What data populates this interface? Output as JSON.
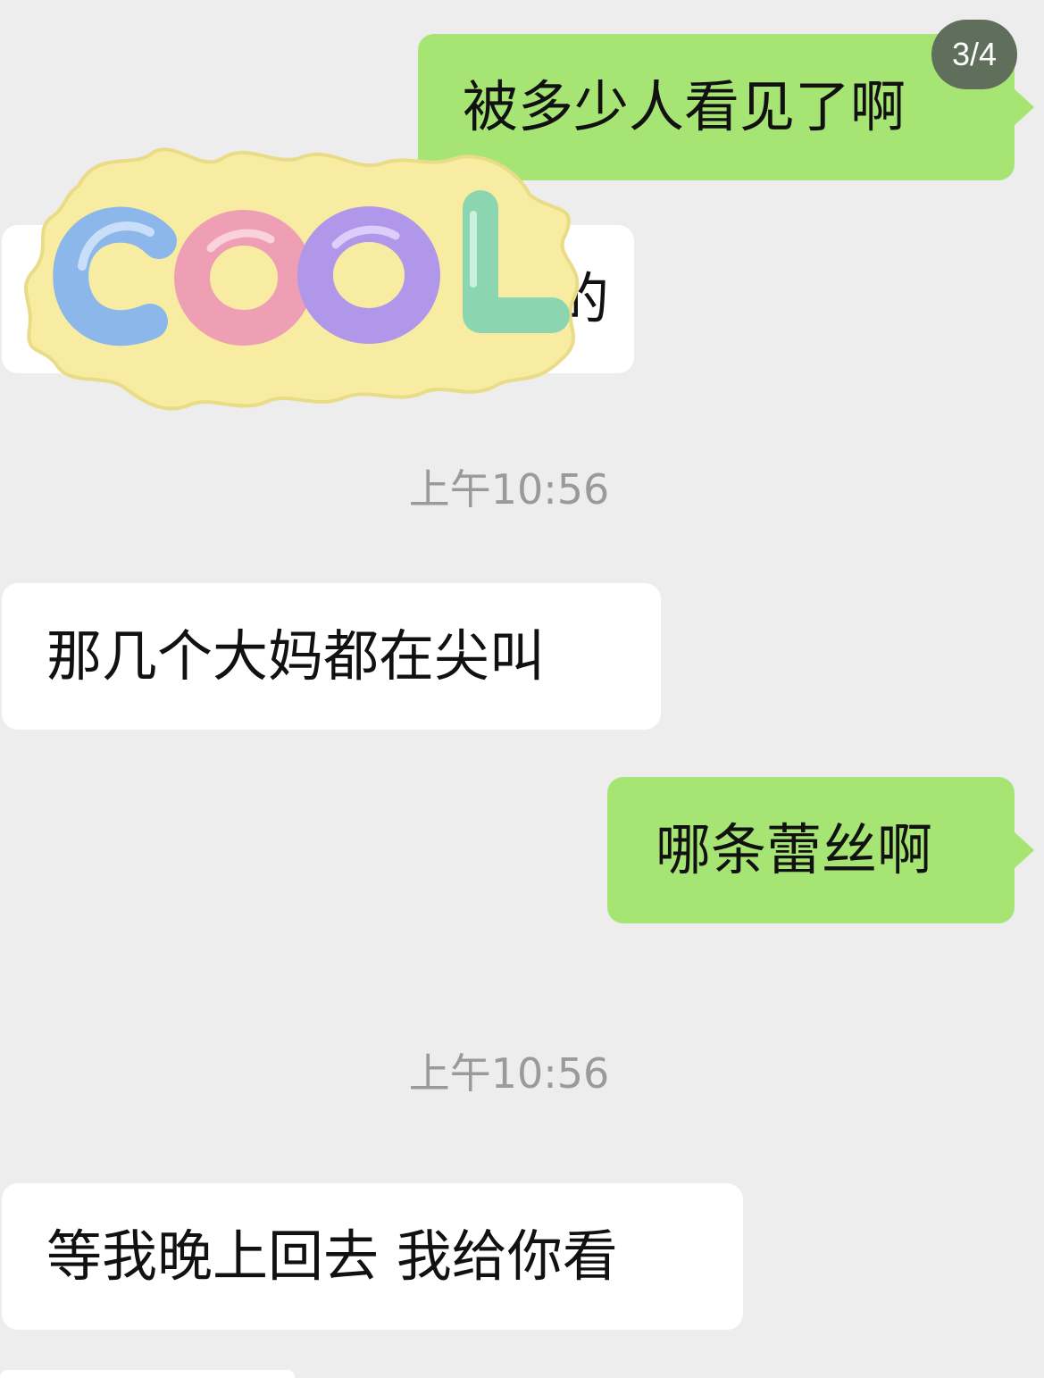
{
  "page_indicator": "3/4",
  "messages": [
    {
      "side": "out",
      "text": "被多少人看见了啊"
    },
    {
      "side": "in",
      "text": "的"
    },
    {
      "side": "in",
      "text": "那几个大妈都在尖叫"
    },
    {
      "side": "out",
      "text": "哪条蕾丝啊"
    },
    {
      "side": "in",
      "text": "等我晚上回去 我给你看"
    }
  ],
  "timestamps": [
    "上午10:56",
    "上午10:56"
  ],
  "sticker": {
    "text": "COOL",
    "letters": [
      "C",
      "O",
      "O",
      "L"
    ]
  },
  "colors": {
    "background": "#ededed",
    "outgoing_bubble": "#a6e573",
    "incoming_bubble": "#ffffff",
    "timestamp_text": "#9a9a9a",
    "badge_background": "#5f6f5c"
  }
}
